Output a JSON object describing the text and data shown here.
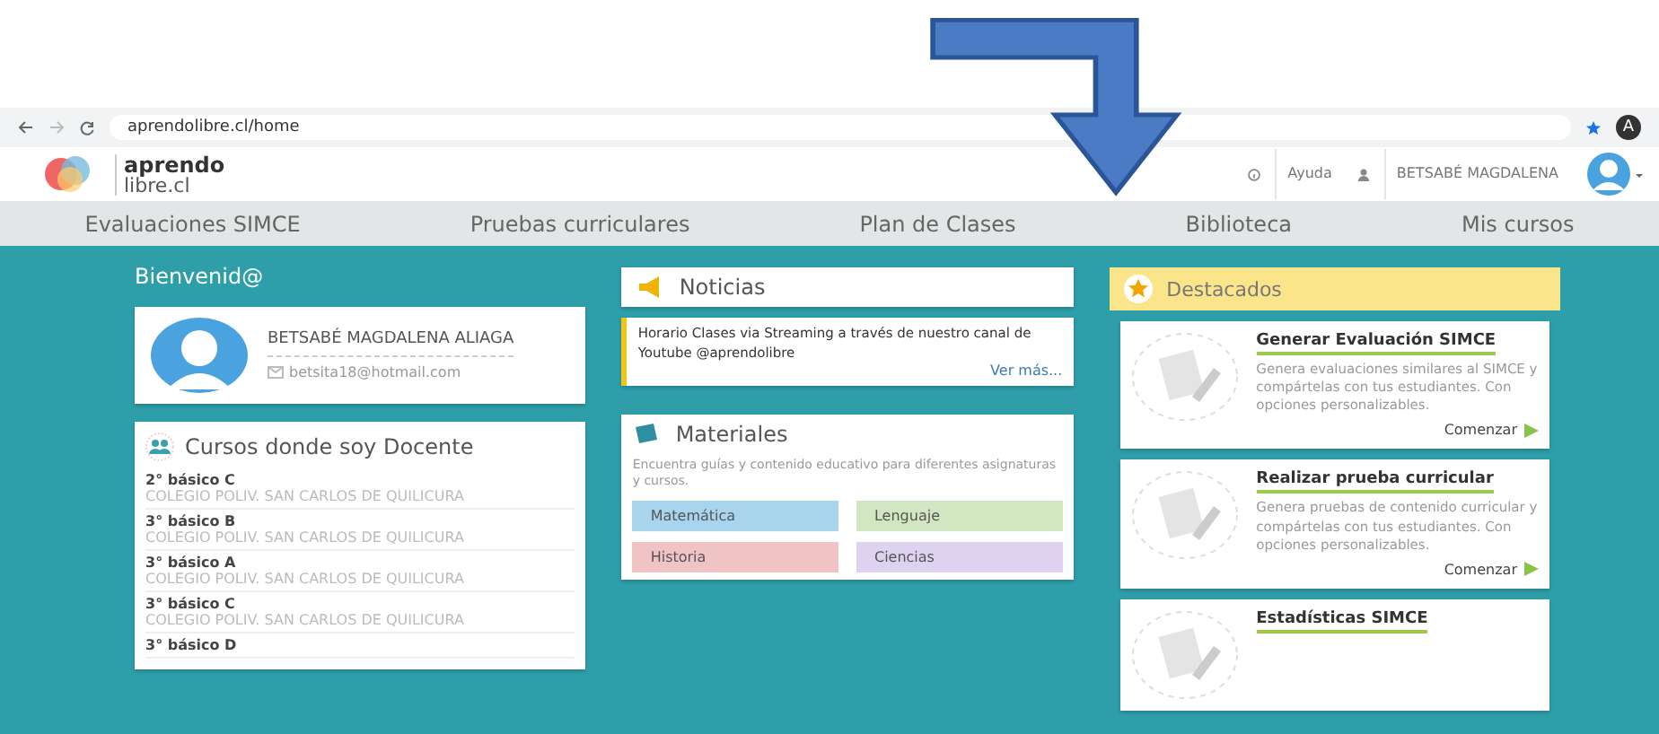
{
  "browser": {
    "url": "aprendolibre.cl/home",
    "profile_initial": "A"
  },
  "header": {
    "logo_top": "aprendo",
    "logo_bottom": "libre.cl",
    "help": "Ayuda",
    "user": "BETSABÉ MAGDALENA"
  },
  "nav": [
    {
      "label": "Evaluaciones SIMCE"
    },
    {
      "label": "Pruebas curriculares"
    },
    {
      "label": "Plan de Clases"
    },
    {
      "label": "Biblioteca"
    },
    {
      "label": "Mis cursos"
    }
  ],
  "welcome": "Bienvenid@",
  "profile": {
    "name": "BETSABÉ MAGDALENA ALIAGA",
    "email": "betsita18@hotmail.com"
  },
  "courses": {
    "title": "Cursos donde soy Docente",
    "items": [
      {
        "name": "2° básico C",
        "school": "COLEGIO POLIV. SAN CARLOS DE QUILICURA"
      },
      {
        "name": "3° básico B",
        "school": "COLEGIO POLIV. SAN CARLOS DE QUILICURA"
      },
      {
        "name": "3° básico A",
        "school": "COLEGIO POLIV. SAN CARLOS DE QUILICURA"
      },
      {
        "name": "3° básico C",
        "school": "COLEGIO POLIV. SAN CARLOS DE QUILICURA"
      },
      {
        "name": "3° básico D"
      }
    ]
  },
  "news": {
    "title": "Noticias",
    "text": "Horario Clases via Streaming a través de nuestro canal de Youtube @aprendolibre",
    "more": "Ver más..."
  },
  "materials": {
    "title": "Materiales",
    "text": "Encuentra guías y contenido educativo para diferentes asignaturas y cursos.",
    "subjects": [
      {
        "label": "Matemática",
        "color": "#a9d4ee"
      },
      {
        "label": "Lenguaje",
        "color": "#d3e6c2"
      },
      {
        "label": "Historia",
        "color": "#f0c4c4"
      },
      {
        "label": "Ciencias",
        "color": "#ddd3f0"
      }
    ]
  },
  "featured": {
    "title": "Destacados",
    "items": [
      {
        "title": "Generar Evaluación SIMCE",
        "text": "Genera evaluaciones similares al SIMCE y compártelas con tus estudiantes. Con opciones personalizables.",
        "action": "Comenzar"
      },
      {
        "title": "Realizar prueba curricular",
        "text": "Genera pruebas de contenido curricular y compártelas con tus estudiantes. Con opciones personalizables.",
        "action": "Comenzar"
      },
      {
        "title": "Estadísticas SIMCE"
      }
    ]
  }
}
